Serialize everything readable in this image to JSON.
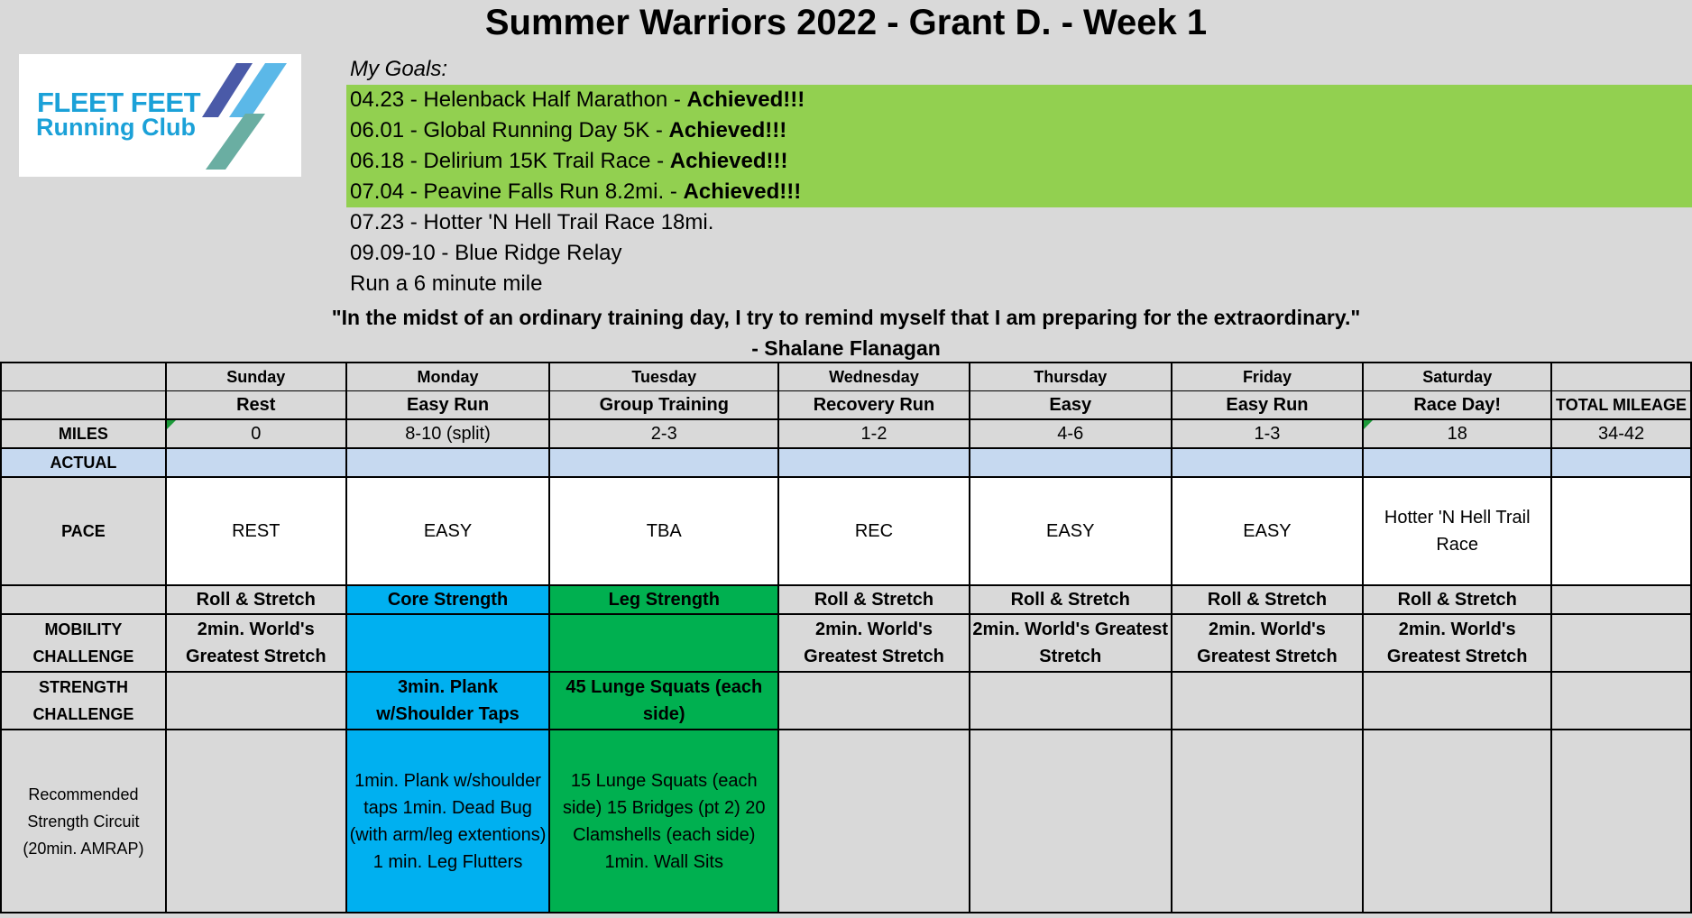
{
  "title": "Summer Warriors 2022 - Grant D. - Week 1",
  "logo": {
    "line1": "FLEET FEET",
    "line2": "Running Club"
  },
  "goals": {
    "header": "My Goals:",
    "items": [
      {
        "text": "04.23 - Helenback Half Marathon - ",
        "status": "Achieved!!!"
      },
      {
        "text": "06.01 - Global Running Day 5K - ",
        "status": "Achieved!!!"
      },
      {
        "text": "06.18 - Delirium 15K Trail Race - ",
        "status": "Achieved!!!"
      },
      {
        "text": "07.04 - Peavine Falls Run 8.2mi. - ",
        "status": "Achieved!!!"
      },
      {
        "text": "07.23 - Hotter 'N Hell Trail Race 18mi.",
        "status": ""
      },
      {
        "text": "09.09-10 - Blue Ridge Relay",
        "status": ""
      },
      {
        "text": "Run a 6 minute mile",
        "status": ""
      }
    ],
    "achieved_color": "#92d050"
  },
  "quote": {
    "text": "\"In the midst of an ordinary training day, I try to remind myself that I am preparing for the extraordinary.\"",
    "author": "- Shalane Flanagan"
  },
  "schedule": {
    "days": [
      "Sunday",
      "Monday",
      "Tuesday",
      "Wednesday",
      "Thursday",
      "Friday",
      "Saturday"
    ],
    "types": [
      "Rest",
      "Easy Run",
      "Group Training",
      "Recovery Run",
      "Easy",
      "Easy Run",
      "Race Day!"
    ],
    "total_header": "TOTAL MILEAGE",
    "miles_label": "MILES",
    "miles": [
      "0",
      "8-10 (split)",
      "2-3",
      "1-2",
      "4-6",
      "1-3",
      "18"
    ],
    "total_miles": "34-42",
    "actual_label": "ACTUAL",
    "pace_label": "PACE",
    "pace": [
      "REST",
      "EASY",
      "TBA",
      "REC",
      "EASY",
      "EASY",
      "Hotter 'N Hell Trail Race"
    ],
    "workout_type": [
      "Roll & Stretch",
      "Core Strength",
      "Leg Strength",
      "Roll & Stretch",
      "Roll & Stretch",
      "Roll & Stretch",
      "Roll & Stretch"
    ],
    "mobility_label": "MOBILITY CHALLENGE",
    "mobility": [
      "2min. World's Greatest Stretch",
      "",
      "",
      "2min. World's Greatest Stretch",
      "2min. World's Greatest Stretch",
      "2min. World's Greatest Stretch",
      "2min. World's Greatest Stretch"
    ],
    "strength_label": "STRENGTH CHALLENGE",
    "strength": [
      "",
      "3min. Plank w/Shoulder Taps",
      "45 Lunge Squats (each side)",
      "",
      "",
      "",
      ""
    ],
    "circuit_label": "Recommended Strength Circuit (20min. AMRAP)",
    "circuit": [
      "",
      "1min. Plank w/shoulder taps 1min. Dead Bug (with arm/leg extentions) 1 min. Leg Flutters",
      "15 Lunge Squats (each side) 15 Bridges (pt 2) 20 Clamshells (each side) 1min. Wall Sits",
      "",
      "",
      "",
      ""
    ],
    "colors": {
      "actual_row": "#c6d9f0",
      "core": "#00b0f0",
      "leg": "#00b050"
    }
  }
}
